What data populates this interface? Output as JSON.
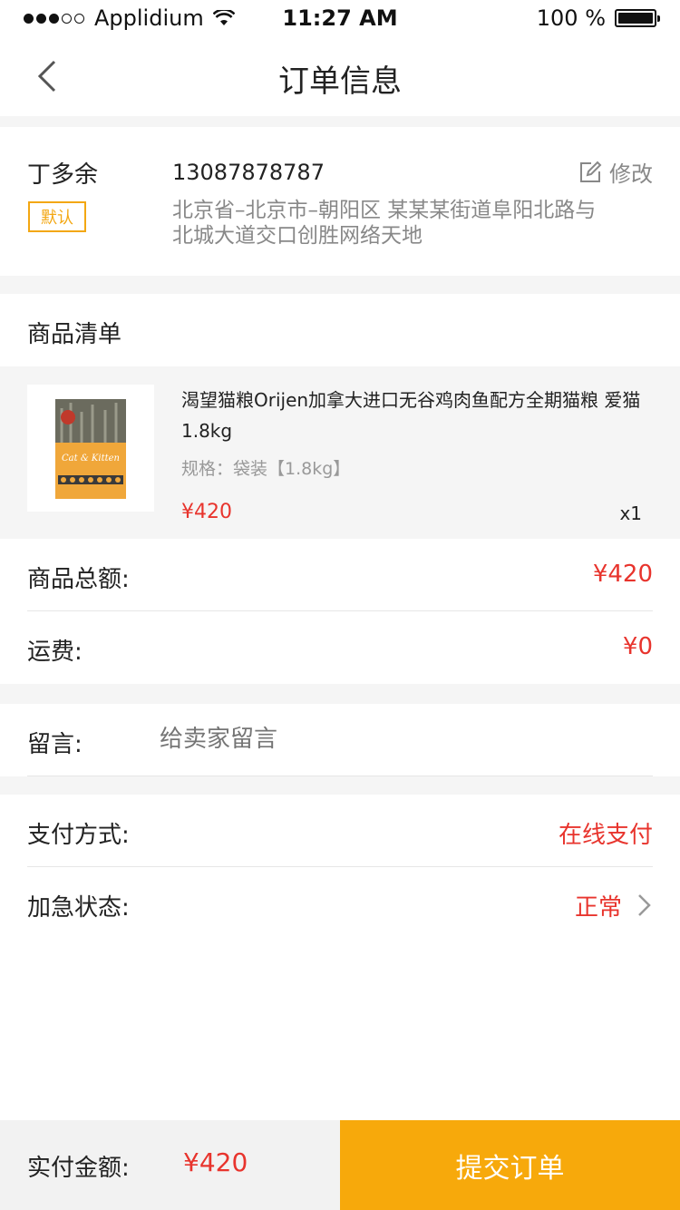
{
  "status_bar": {
    "carrier": "Applidium",
    "time": "11:27 AM",
    "battery": "100 %"
  },
  "nav": {
    "title": "订单信息"
  },
  "address": {
    "name": "丁多余",
    "phone": "13087878787",
    "edit_label": "修改",
    "default_badge": "默认",
    "detail": "北京省–北京市–朝阳区 某某某街道阜阳北路与北城大道交口创胜网络天地"
  },
  "goods": {
    "header": "商品清单",
    "item": {
      "title": "渴望猫粮Orijen加拿大进口无谷鸡肉鱼配方全期猫粮 爱猫1.8kg",
      "spec": "规格：袋装【1.8kg】",
      "price": "¥420",
      "qty": "x1",
      "thumb_text": "Cat & Kitten"
    }
  },
  "summary": {
    "total_label": "商品总额:",
    "total_value": "¥420",
    "shipping_label": "运费:",
    "shipping_value": "¥0"
  },
  "message": {
    "label": "留言:",
    "placeholder": "给卖家留言"
  },
  "payment": {
    "method_label": "支付方式:",
    "method_value": "在线支付",
    "urgent_label": "加急状态:",
    "urgent_value": "正常"
  },
  "bottom": {
    "paid_label": "实付金额:",
    "paid_amount": "¥420",
    "submit_label": "提交订单"
  },
  "colors": {
    "accent": "#f7a90b",
    "price_red": "#e8342d",
    "badge_orange": "#f3a712"
  }
}
